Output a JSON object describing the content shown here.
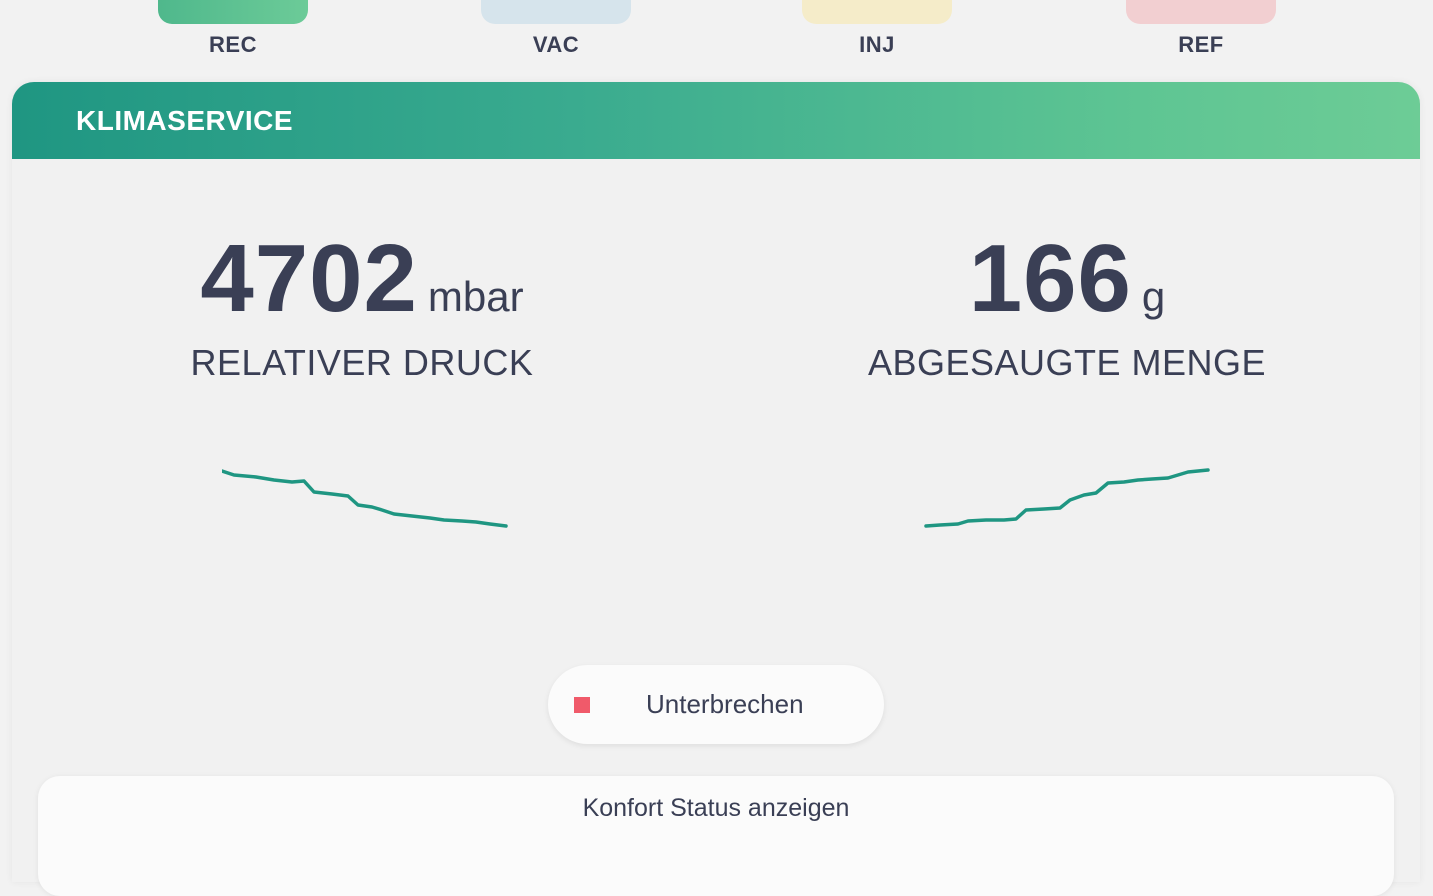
{
  "steps": [
    {
      "label": "REC",
      "color": "#5cc391"
    },
    {
      "label": "VAC",
      "color": "#d6e4ec"
    },
    {
      "label": "INJ",
      "color": "#f5ecc9"
    },
    {
      "label": "REF",
      "color": "#f2cfd1"
    }
  ],
  "card": {
    "title": "KLIMASERVICE",
    "pressure": {
      "value": "4702",
      "unit": "mbar",
      "label": "RELATIVER DRUCK"
    },
    "amount": {
      "value": "166",
      "unit": "g",
      "label": "ABGESAUGTE MENGE"
    },
    "line_color": "#1f9682",
    "pause_button": {
      "label": "Unterbrechen",
      "icon": "stop-icon",
      "icon_color": "#f05a6a"
    },
    "comfort_status": {
      "label": "Konfort Status anzeigen"
    }
  }
}
